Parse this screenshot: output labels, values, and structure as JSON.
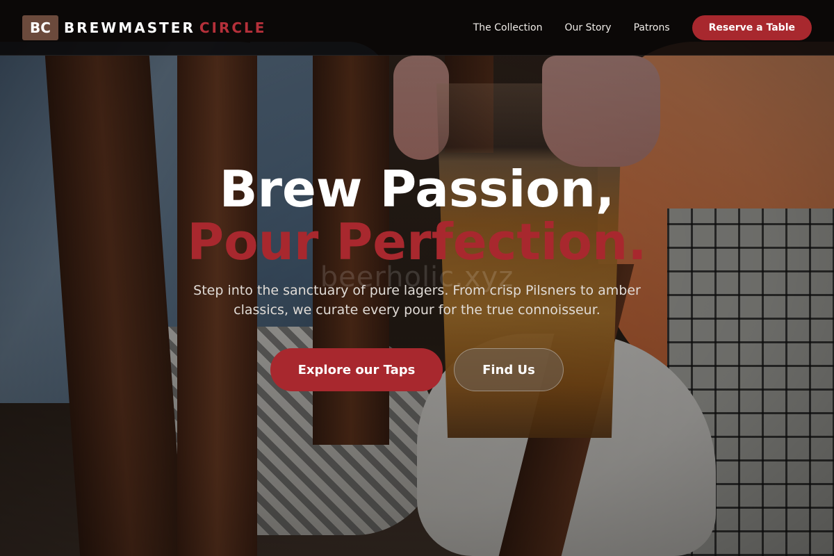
{
  "nav": {
    "logo_badge": "BC",
    "brand_primary": "BREWMASTER",
    "brand_accent": "CIRCLE",
    "links": [
      {
        "label": "The Collection"
      },
      {
        "label": "Our Story"
      },
      {
        "label": "Patrons"
      }
    ],
    "cta_label": "Reserve a Table"
  },
  "hero": {
    "title_line1": "Brew Passion,",
    "title_line2": "Pour Perfection.",
    "watermark": "beerholic.xyz",
    "subtitle": "Step into the sanctuary of pure lagers. From crisp Pilsners to amber classics, we curate every pour for the true connoisseur.",
    "primary_button": "Explore our Taps",
    "secondary_button": "Find Us"
  },
  "colors": {
    "accent": "#a8282e",
    "navbar_bg": "#080606",
    "logo_badge_bg": "#6b4a3c"
  }
}
